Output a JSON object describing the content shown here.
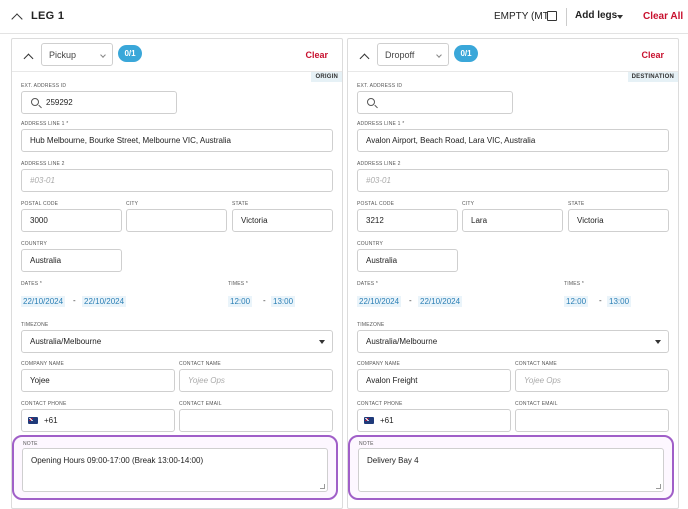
{
  "leg": {
    "title": "LEG 1",
    "empty_label": "EMPTY (MT)",
    "add_legs": "Add legs",
    "clear_all": "Clear All"
  },
  "pickup": {
    "type": "Pickup",
    "count": "0/1",
    "clear": "Clear",
    "role": "ORIGIN",
    "ext_id_label": "EXT. ADDRESS ID",
    "ext_id": "259292",
    "addr1_label": "ADDRESS LINE 1 *",
    "addr1": "Hub Melbourne, Bourke Street, Melbourne VIC, Australia",
    "addr2_label": "ADDRESS LINE 2",
    "addr2_ph": "#03-01",
    "postal_label": "POSTAL CODE",
    "postal": "3000",
    "city_label": "CITY",
    "city": "",
    "state_label": "STATE",
    "state": "Victoria",
    "country_label": "COUNTRY",
    "country": "Australia",
    "dates_label": "DATES *",
    "date_from": "22/10/2024",
    "date_sep": "-",
    "date_to": "22/10/2024",
    "times_label": "TIMES *",
    "time_from": "12:00",
    "time_sep": "-",
    "time_to": "13:00",
    "tz_label": "TIMEZONE",
    "tz": "Australia/Melbourne",
    "company_label": "COMPANY NAME",
    "company": "Yojee",
    "contact_label": "CONTACT NAME",
    "contact_ph": "Yojee Ops",
    "phone_label": "CONTACT PHONE",
    "phone": "+61",
    "email_label": "CONTACT EMAIL",
    "email": "",
    "note_label": "NOTE",
    "note": "Opening Hours 09:00-17:00 (Break 13:00-14:00)"
  },
  "dropoff": {
    "type": "Dropoff",
    "count": "0/1",
    "clear": "Clear",
    "role": "DESTINATION",
    "ext_id_label": "EXT. ADDRESS ID",
    "ext_id": "",
    "addr1_label": "ADDRESS LINE 1 *",
    "addr1": "Avalon Airport, Beach Road, Lara VIC, Australia",
    "addr2_label": "ADDRESS LINE 2",
    "addr2_ph": "#03-01",
    "postal_label": "POSTAL CODE",
    "postal": "3212",
    "city_label": "CITY",
    "city": "Lara",
    "state_label": "STATE",
    "state": "Victoria",
    "country_label": "COUNTRY",
    "country": "Australia",
    "dates_label": "DATES *",
    "date_from": "22/10/2024",
    "date_sep": "-",
    "date_to": "22/10/2024",
    "times_label": "TIMES *",
    "time_from": "12:00",
    "time_sep": "-",
    "time_to": "13:00",
    "tz_label": "TIMEZONE",
    "tz": "Australia/Melbourne",
    "company_label": "COMPANY NAME",
    "company": "Avalon Freight",
    "contact_label": "CONTACT NAME",
    "contact_ph": "Yojee Ops",
    "phone_label": "CONTACT PHONE",
    "phone": "+61",
    "email_label": "CONTACT EMAIL",
    "email": "",
    "note_label": "NOTE",
    "note": "Delivery Bay 4"
  },
  "colors": {
    "accent": "#3aa7d9",
    "danger": "#c8102e",
    "note_highlight": "#a05fc8"
  },
  "icons": {
    "collapse": "chevron-up-icon",
    "search": "search-icon",
    "flag": "australia-flag-icon",
    "dropdown": "caret-down-icon"
  }
}
